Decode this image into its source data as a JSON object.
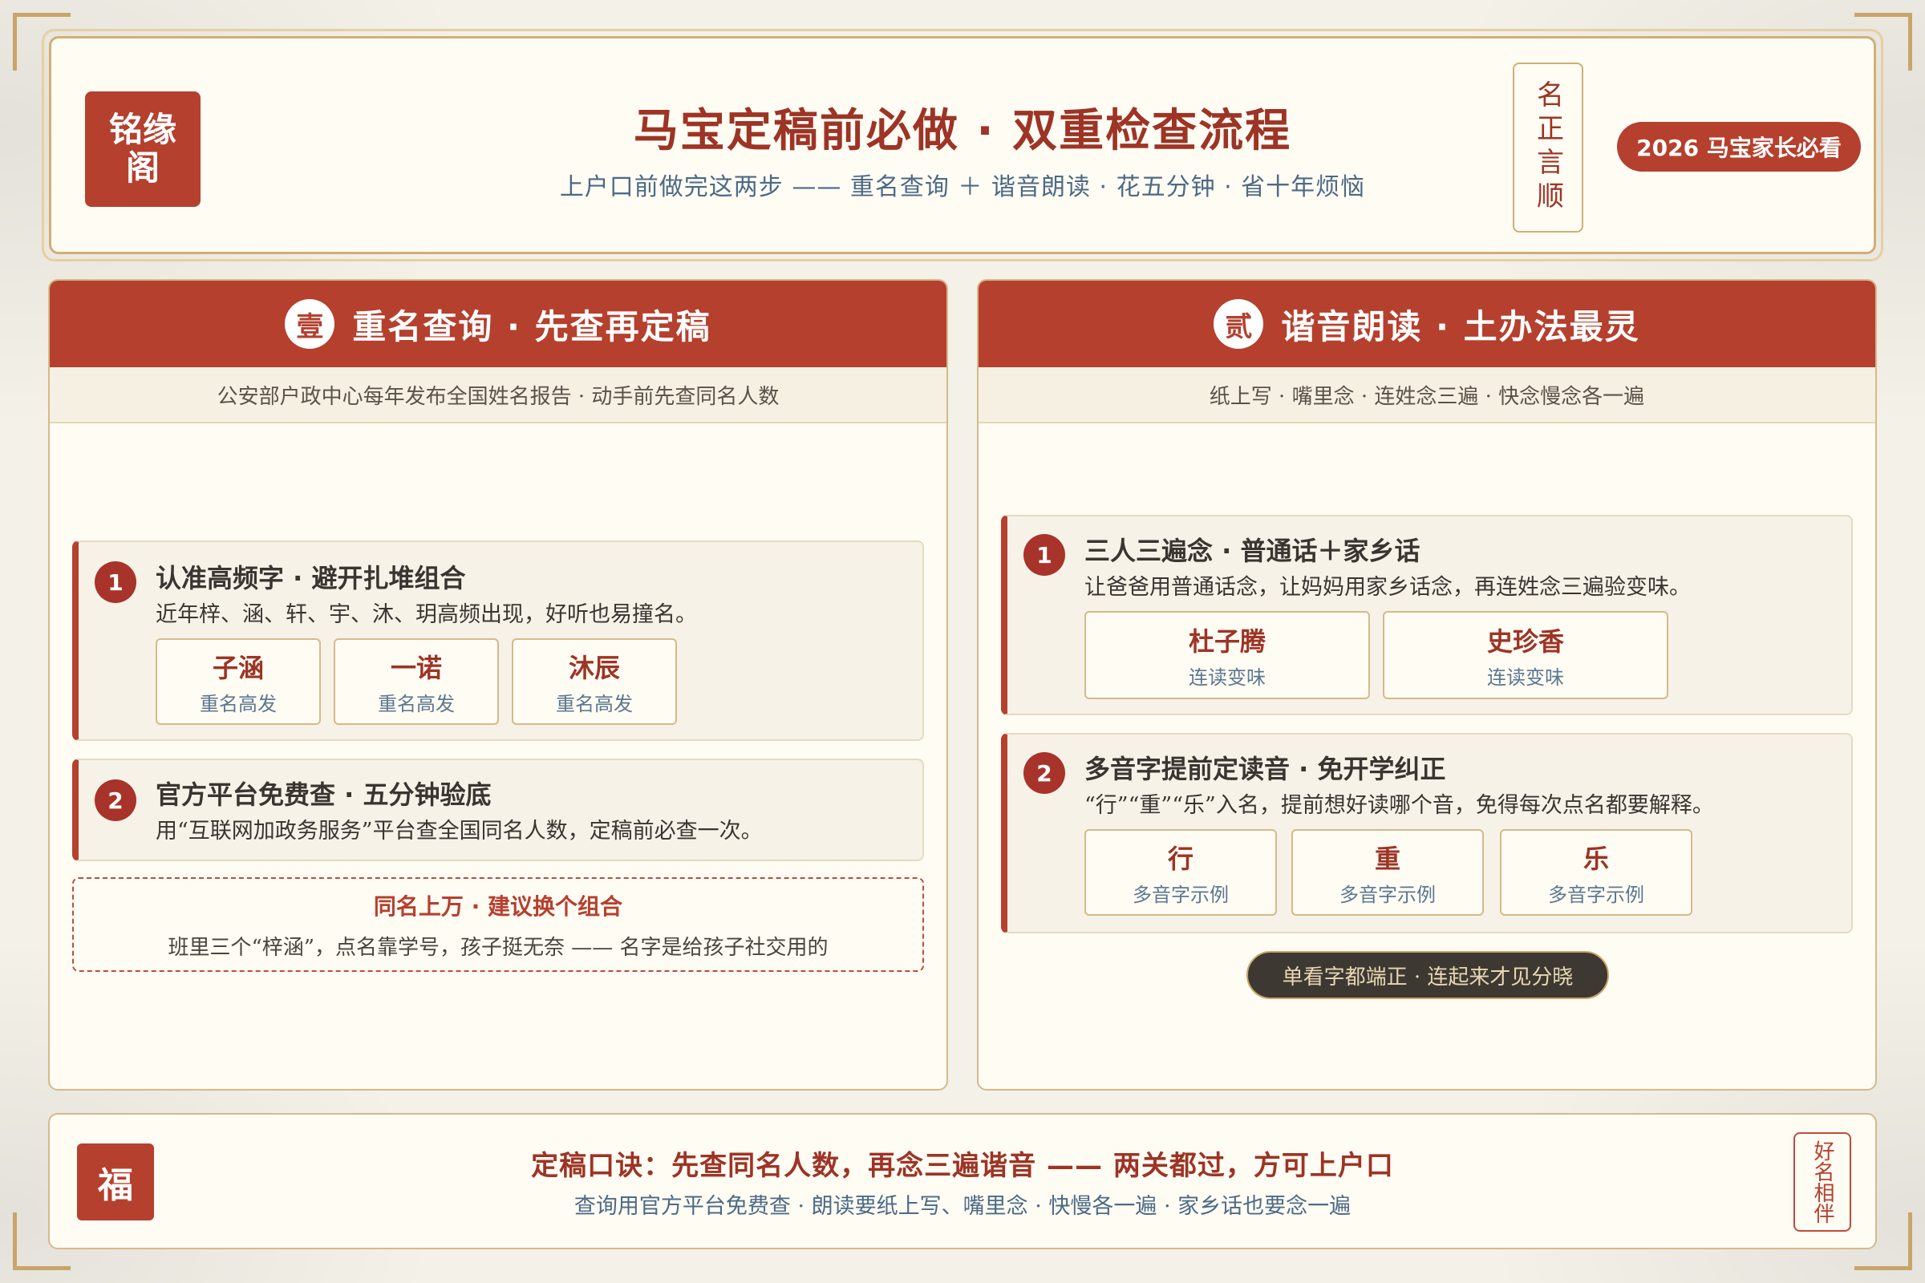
{
  "header": {
    "seal": "铭缘阁",
    "title": "马宝定稿前必做 · 双重检查流程",
    "subtitle": "上户口前做完这两步 —— 重名查询 ＋ 谐音朗读 · 花五分钟 · 省十年烦恼",
    "vertical_stamp": "名正言顺",
    "badge": "2026 马宝家长必看"
  },
  "left_panel": {
    "number": "壹",
    "title": "重名查询 · 先查再定稿",
    "subtitle": "公安部户政中心每年发布全国姓名报告 · 动手前先查同名人数",
    "steps": [
      {
        "badge": "1",
        "title": "认准高频字 · 避开扎堆组合",
        "desc": "近年梓、涵、轩、宇、沐、玥高频出现，好听也易撞名。",
        "tags": [
          {
            "name": "子涵",
            "note": "重名高发"
          },
          {
            "name": "一诺",
            "note": "重名高发"
          },
          {
            "name": "沐辰",
            "note": "重名高发"
          }
        ]
      },
      {
        "badge": "2",
        "title": "官方平台免费查 · 五分钟验底",
        "desc": "用“互联网加政务服务”平台查全国同名人数，定稿前必查一次。"
      }
    ],
    "warning": {
      "title": "同名上万 · 建议换个组合",
      "text": "班里三个“梓涵”，点名靠学号，孩子挺无奈 —— 名字是给孩子社交用的"
    }
  },
  "right_panel": {
    "number": "贰",
    "title": "谐音朗读 · 土办法最灵",
    "subtitle": "纸上写 · 嘴里念 · 连姓念三遍 · 快念慢念各一遍",
    "steps": [
      {
        "badge": "1",
        "title": "三人三遍念 · 普通话＋家乡话",
        "desc": "让爸爸用普通话念，让妈妈用家乡话念，再连姓念三遍验变味。",
        "tags": [
          {
            "name": "杜子腾",
            "note": "连读变味"
          },
          {
            "name": "史珍香",
            "note": "连读变味"
          }
        ]
      },
      {
        "badge": "2",
        "title": "多音字提前定读音 · 免开学纠正",
        "desc": "“行”“重”“乐”入名，提前想好读哪个音，免得每次点名都要解释。",
        "tags": [
          {
            "name": "行",
            "note": "多音字示例"
          },
          {
            "name": "重",
            "note": "多音字示例"
          },
          {
            "name": "乐",
            "note": "多音字示例"
          }
        ]
      }
    ],
    "tip": "单看字都端正 · 连起来才见分晓"
  },
  "footer": {
    "seal": "福",
    "title": "定稿口诀：先查同名人数，再念三遍谐音 —— 两关都过，方可上户口",
    "subtitle": "查询用官方平台免费查 · 朗读要纸上写、嘴里念 · 快慢各一遍 · 家乡话也要念一遍",
    "stamp": "好名相伴"
  },
  "colors": {
    "accent_red": "#b5402e",
    "gold": "#c8a56a",
    "paper": "#fffcf4",
    "blue_text": "#4c6a86"
  }
}
